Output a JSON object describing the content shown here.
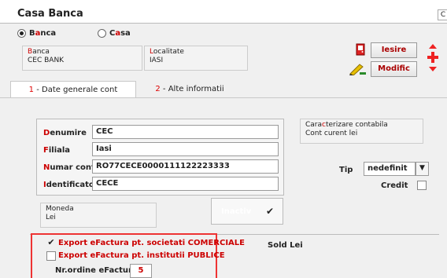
{
  "window": {
    "title": "Casa Banca",
    "corner_glyph": "C"
  },
  "type_selector": {
    "options": [
      {
        "label": "Banca",
        "selected": true
      },
      {
        "label": "Casa",
        "selected": false
      }
    ]
  },
  "bank_info": {
    "bank_label": "Banca",
    "bank_value": "CEC BANK",
    "locality_label": "Localitate",
    "locality_value": "IASI"
  },
  "toolbar": {
    "exit_label": "Iesire",
    "modify_label": "Modific",
    "exit_icon": "door-exit-icon",
    "modify_icon": "pencil-edit-icon"
  },
  "tabs": [
    {
      "num": "1",
      "label": " - Date generale cont",
      "active": true
    },
    {
      "num": "2",
      "label": " - Alte informatii",
      "active": false
    }
  ],
  "account_form": {
    "fields": [
      {
        "label": "Denumire",
        "value": "CEC"
      },
      {
        "label": "Filiala",
        "value": "Iasi"
      },
      {
        "label": "Numar cont",
        "value": "RO77CECE0000111122223333"
      },
      {
        "label": "Identificator",
        "value": "CECE"
      }
    ]
  },
  "accounting": {
    "label": "Caracterizare contabila",
    "value": "Cont curent lei"
  },
  "tip": {
    "label": "Tip",
    "value": "nedefinit"
  },
  "credit": {
    "label": "Credit",
    "checked": false
  },
  "currency": {
    "label": "Moneda",
    "value": "Lei"
  },
  "inactive": {
    "label": "Inactiv",
    "checked": true
  },
  "efactura": {
    "commercial_label": "Export eFactura pt. societati COMERCIALE",
    "commercial_checked": true,
    "public_label": "Export eFactura pt. institutii PUBLICE",
    "public_checked": false,
    "order_label": "Nr.ordine eFactura",
    "order_value": "5"
  },
  "balance": {
    "label": "Sold Lei"
  },
  "colors": {
    "accent_red": "#cc0000",
    "frame_red": "#ee3333"
  }
}
